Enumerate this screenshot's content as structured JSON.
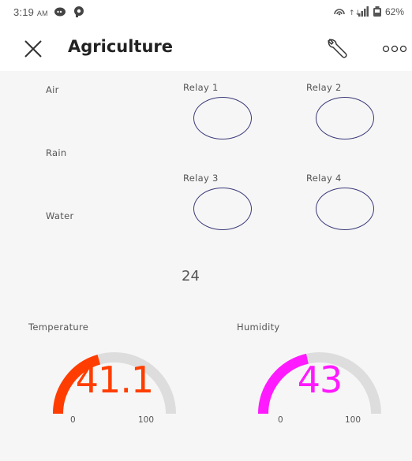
{
  "status_bar": {
    "time": "3:19",
    "ampm": "AM",
    "battery": "62%"
  },
  "header": {
    "title": "Agriculture",
    "icons": [
      "close-icon",
      "wrench-icon",
      "more-icon"
    ]
  },
  "sensors": {
    "air_label": "Air",
    "rain_label": "Rain",
    "water_label": "Water"
  },
  "relays": [
    {
      "label": "Relay 1"
    },
    {
      "label": "Relay 2"
    },
    {
      "label": "Relay 3"
    },
    {
      "label": "Relay 4"
    }
  ],
  "value_display": "24",
  "gauges": {
    "temperature": {
      "label": "Temperature",
      "value": "41.1",
      "min": "0",
      "max": "100",
      "color": "#ff3d00",
      "fraction": 0.411
    },
    "humidity": {
      "label": "Humidity",
      "value": "43",
      "min": "0",
      "max": "100",
      "color": "#ff1aff",
      "fraction": 0.43
    }
  },
  "colors": {
    "background": "#f6f6f6",
    "relay_border": "#3a3a7a",
    "gauge_track": "#dddddd"
  }
}
